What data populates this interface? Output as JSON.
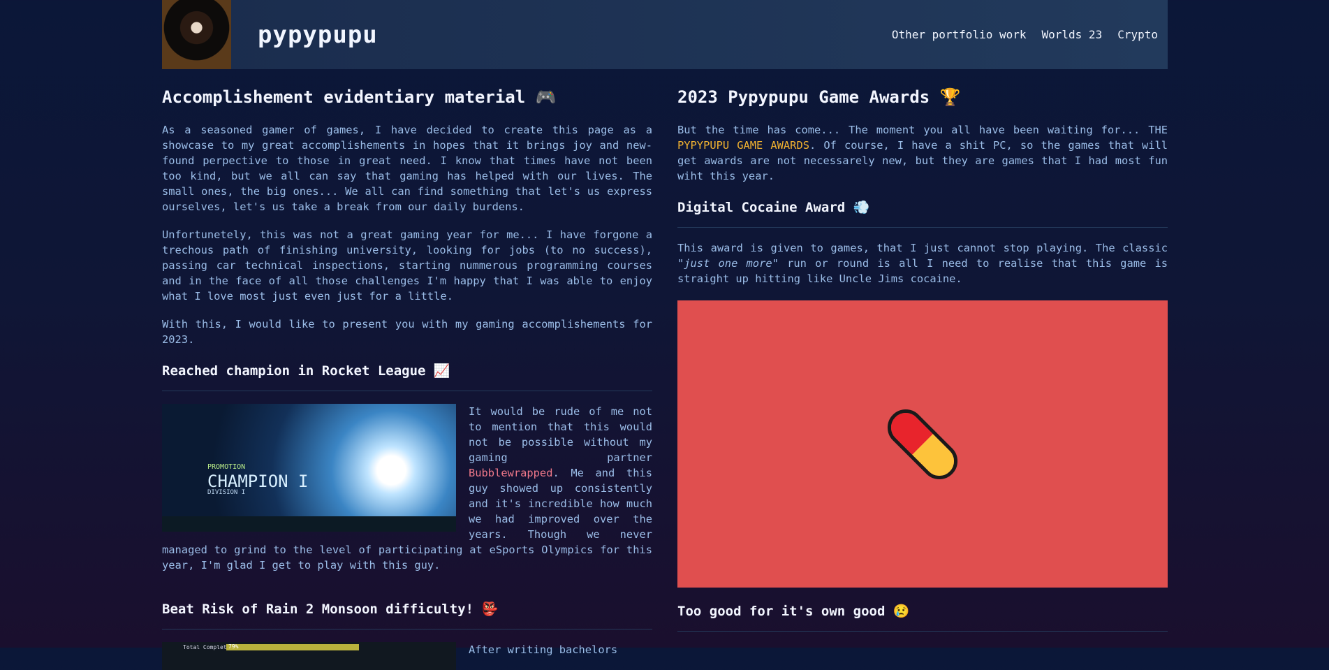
{
  "header": {
    "brand": "pypypupu",
    "nav": [
      "Other portfolio work",
      "Worlds 23",
      "Crypto"
    ]
  },
  "left": {
    "title": "Accomplishement evidentiary material 🎮",
    "p1": "As a seasoned gamer of games, I have decided to create this page as a showcase to my great accomplishements in hopes that it brings joy and new-found perpective to those in great need. I know that times have not been too kind, but we all can say that gaming has helped with our lives. The small ones, the big ones... We all can find something that let's us express ourselves, let's us take a break from our daily burdens.",
    "p2": "Unfortunetely, this was not a great gaming year for me... I have forgone a trechous path of finishing university, looking for jobs (to no success), passing car technical inspections, starting nummerous programming courses and in the face of all those challenges I'm happy that I was able to enjoy what I love most just even just for a little.",
    "p3": "With this, I would like to present you with my gaming accomplishements for 2023.",
    "rl": {
      "title": "Reached champion in Rocket League 📈",
      "img": {
        "promo": "PROMOTION",
        "rank": "CHAMPION I",
        "division": "DIVISION I"
      },
      "before": "It would be rude of me not to mention that this would not be possible without my gaming partner ",
      "partner": "Bubblewrapped",
      "after": ". Me and this guy showed up consistently and it's incredible how much we had improved over the years. Though we never managed to grind to the level of participating at eSports Olympics for this year, I'm glad I get to play with this guy."
    },
    "ror": {
      "title": "Beat Risk of Rain 2 Monsoon difficulty! 👺",
      "img": {
        "label": "Total Completion",
        "pct": "79%",
        "fill": 0.79
      },
      "text": "After writing bachelors"
    }
  },
  "right": {
    "title": "2023 Pypypupu Game Awards 🏆",
    "intro_before": "But the time has come... The moment you all have been waiting for... THE ",
    "intro_hl": "PYPYPUPU GAME AWARDS",
    "intro_after": ". Of course, I have a shit PC, so the games that will get awards are not necessarely new, but they are games that I had most fun wiht this year.",
    "award1": {
      "title": "Digital Cocaine Award 💨",
      "before": "This award is given to games, that I just cannot stop playing. The classic ",
      "em": "\"just one more\"",
      "after": " run or round is all I need to realise that this game is straight up hitting like Uncle Jims cocaine."
    },
    "award2": {
      "title": "Too good for it's own good 😢"
    }
  }
}
